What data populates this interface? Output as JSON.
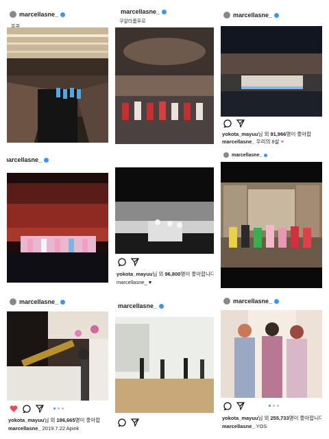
{
  "posts": [
    {
      "username": "marcellasne_",
      "location": "홍콩"
    },
    {
      "username": "marcellasne_",
      "location": "쿠알라룸푸르"
    },
    {
      "username": "marcellasne_",
      "liked_by": "yokota_mayuu",
      "likes_text": "님 외 ",
      "likes_count": "91,966",
      "likes_suffix": "명이 좋아합",
      "caption_user": "marcellasne_",
      "caption": "우리의 8살",
      "icons": [
        "comment-icon",
        "share-icon"
      ]
    },
    {
      "username": "marcellasne_"
    },
    {
      "username": "marcellasne_",
      "liked_by": "yokota_mayuu",
      "likes_text": "님 외 ",
      "likes_count": "96,800",
      "likes_suffix": "명이 좋아합니다",
      "caption_user": "marcellasne_",
      "caption": "",
      "icons": [
        "comment-icon",
        "share-icon"
      ]
    },
    {
      "username": "marcellasne_"
    },
    {
      "username": "marcellasne_",
      "liked_by": "yokota_mayuu",
      "likes_text": "님 외 ",
      "likes_count": "186,665",
      "likes_suffix": "명이 좋아합",
      "caption_user": "marcellasne_",
      "caption": "2019.7.22 Apink",
      "icons": [
        "heart-icon",
        "comment-icon",
        "share-icon"
      ]
    },
    {
      "username": "marcellasne_",
      "icons": [
        "comment-icon",
        "share-icon"
      ]
    },
    {
      "username": "marcellasne_",
      "liked_by": "yokota_mayuu",
      "likes_text": "님 외 ",
      "likes_count": "255,733",
      "likes_suffix": "명이 좋아합니다",
      "caption_user": "marcellasne_",
      "caption": "YOS",
      "icons": [
        "comment-icon",
        "share-icon"
      ]
    }
  ],
  "colors": {
    "verified": "#3897f0",
    "heart": "#ed4956"
  }
}
